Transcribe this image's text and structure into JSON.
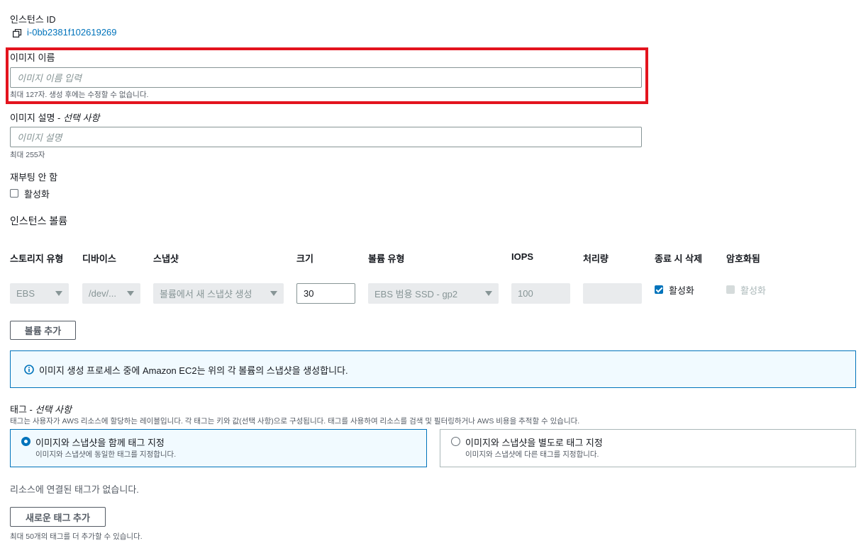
{
  "instance": {
    "label": "인스턴스 ID",
    "id": "i-0bb2381f102619269"
  },
  "image_name": {
    "label": "이미지 이름",
    "placeholder": "이미지 이름 입력",
    "hint": "최대 127자. 생성 후에는 수정할 수 없습니다."
  },
  "image_description": {
    "label": "이미지 설명 - ",
    "label_optional": "선택 사항",
    "placeholder": "이미지 설명",
    "hint": "최대 255자"
  },
  "no_reboot": {
    "label": "재부팅 안 함",
    "checkbox_label": "활성화",
    "checked": false
  },
  "volumes": {
    "section_title": "인스턴스 볼륨",
    "headers": [
      "스토리지 유형",
      "디바이스",
      "스냅샷",
      "크기",
      "볼륨 유형",
      "IOPS",
      "처리량",
      "종료 시 삭제",
      "암호화됨"
    ],
    "row": {
      "storage_type": "EBS",
      "device": "/dev/...",
      "snapshot": "볼륨에서 새 스냅샷 생성",
      "size": "30",
      "volume_type": "EBS 범용 SSD - gp2",
      "iops": "100",
      "throughput": "",
      "delete_on_termination": "활성화",
      "encrypted": "활성화"
    },
    "add_volume_button": "볼륨 추가"
  },
  "info": {
    "message": "이미지 생성 프로세스 중에 Amazon EC2는 위의 각 볼륨의 스냅샷을 생성합니다."
  },
  "tags": {
    "label": "태그 - ",
    "label_optional": "선택 사항",
    "description": "태그는 사용자가 AWS 리소스에 할당하는 레이블입니다. 각 태그는 키와 값(선택 사항)으로 구성됩니다. 태그를 사용하여 리소스를 검색 및 필터링하거나 AWS 비용을 추적할 수 있습니다.",
    "options": [
      {
        "title": "이미지와 스냅샷을 함께 태그 지정",
        "desc": "이미지와 스냅샷에 동일한 태그를 지정합니다.",
        "selected": true
      },
      {
        "title": "이미지와 스냅샷을 별도로 태그 지정",
        "desc": "이미지와 스냅샷에 다른 태그를 지정합니다.",
        "selected": false
      }
    ],
    "empty_message": "리소스에 연결된 태그가 없습니다.",
    "add_tag_button": "새로운 태그 추가",
    "limit_hint": "최대 50개의 태그를 더 추가할 수 있습니다."
  },
  "colors": {
    "accent": "#0073bb",
    "highlight": "#e3141e"
  }
}
